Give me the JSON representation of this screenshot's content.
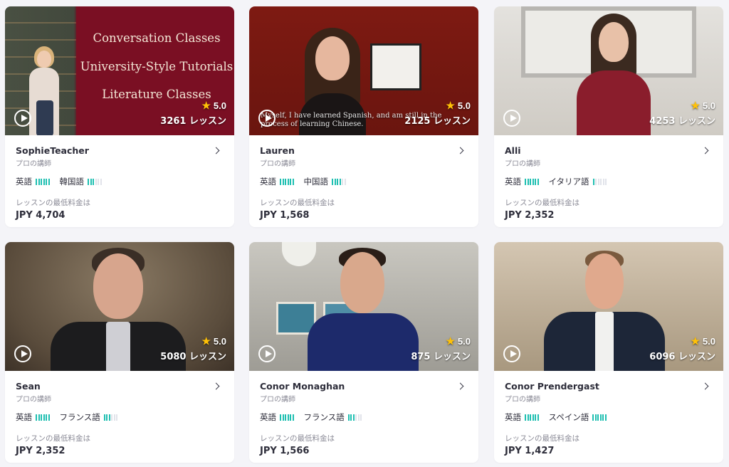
{
  "common": {
    "role": "プロの講師",
    "price_label": "レッスンの最低料金は",
    "rating": "5.0"
  },
  "colors": {
    "accent": "#1ebfb1",
    "star": "#ffc107"
  },
  "icons": {
    "play": "play-icon",
    "star": "star-icon",
    "chevron": "chevron-right-icon"
  },
  "tutors": [
    {
      "name": "SophieTeacher",
      "lessons": "3261 レッスン",
      "price": "JPY 4,704",
      "promo": [
        "Conversation Classes",
        "University-Style Tutorials",
        "Literature Classes"
      ],
      "langs": [
        {
          "label": "英語",
          "level": 6
        },
        {
          "label": "韓国語",
          "level": 3
        }
      ]
    },
    {
      "name": "Lauren",
      "lessons": "2125 レッスン",
      "price": "JPY 1,568",
      "caption": "Myself, I have learned Spanish, and am still in the process of learning Chinese.",
      "langs": [
        {
          "label": "英語",
          "level": 6
        },
        {
          "label": "中国語",
          "level": 4
        }
      ]
    },
    {
      "name": "Alli",
      "lessons": "4253 レッスン",
      "price": "JPY 2,352",
      "langs": [
        {
          "label": "英語",
          "level": 6
        },
        {
          "label": "イタリア語",
          "level": 1
        }
      ]
    },
    {
      "name": "Sean",
      "lessons": "5080 レッスン",
      "price": "JPY 2,352",
      "langs": [
        {
          "label": "英語",
          "level": 6
        },
        {
          "label": "フランス語",
          "level": 3
        }
      ]
    },
    {
      "name": "Conor Monaghan",
      "lessons": "875 レッスン",
      "price": "JPY 1,566",
      "langs": [
        {
          "label": "英語",
          "level": 6
        },
        {
          "label": "フランス語",
          "level": 3
        }
      ]
    },
    {
      "name": "Conor Prendergast",
      "lessons": "6096 レッスン",
      "price": "JPY 1,427",
      "langs": [
        {
          "label": "英語",
          "level": 6
        },
        {
          "label": "スペイン語",
          "level": 6
        }
      ]
    }
  ]
}
